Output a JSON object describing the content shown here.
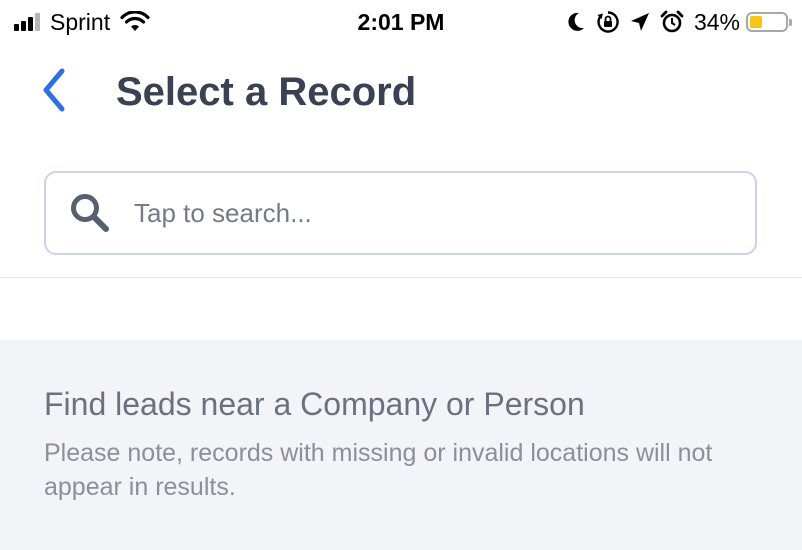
{
  "status_bar": {
    "carrier": "Sprint",
    "time": "2:01 PM",
    "battery_percent": "34%",
    "battery_level": 0.34,
    "icons": [
      "signal-bars",
      "wifi",
      "do-not-disturb-moon",
      "orientation-lock",
      "location-arrow",
      "alarm-clock",
      "battery"
    ]
  },
  "nav": {
    "title": "Select a Record",
    "back_icon": "chevron-left",
    "accent_color": "#2f6fe4"
  },
  "search": {
    "placeholder": "Tap to search...",
    "value": "",
    "icon": "search"
  },
  "info": {
    "heading": "Find leads near a Company or Person",
    "note": "Please note, records with missing or invalid locations will not appear in results."
  }
}
